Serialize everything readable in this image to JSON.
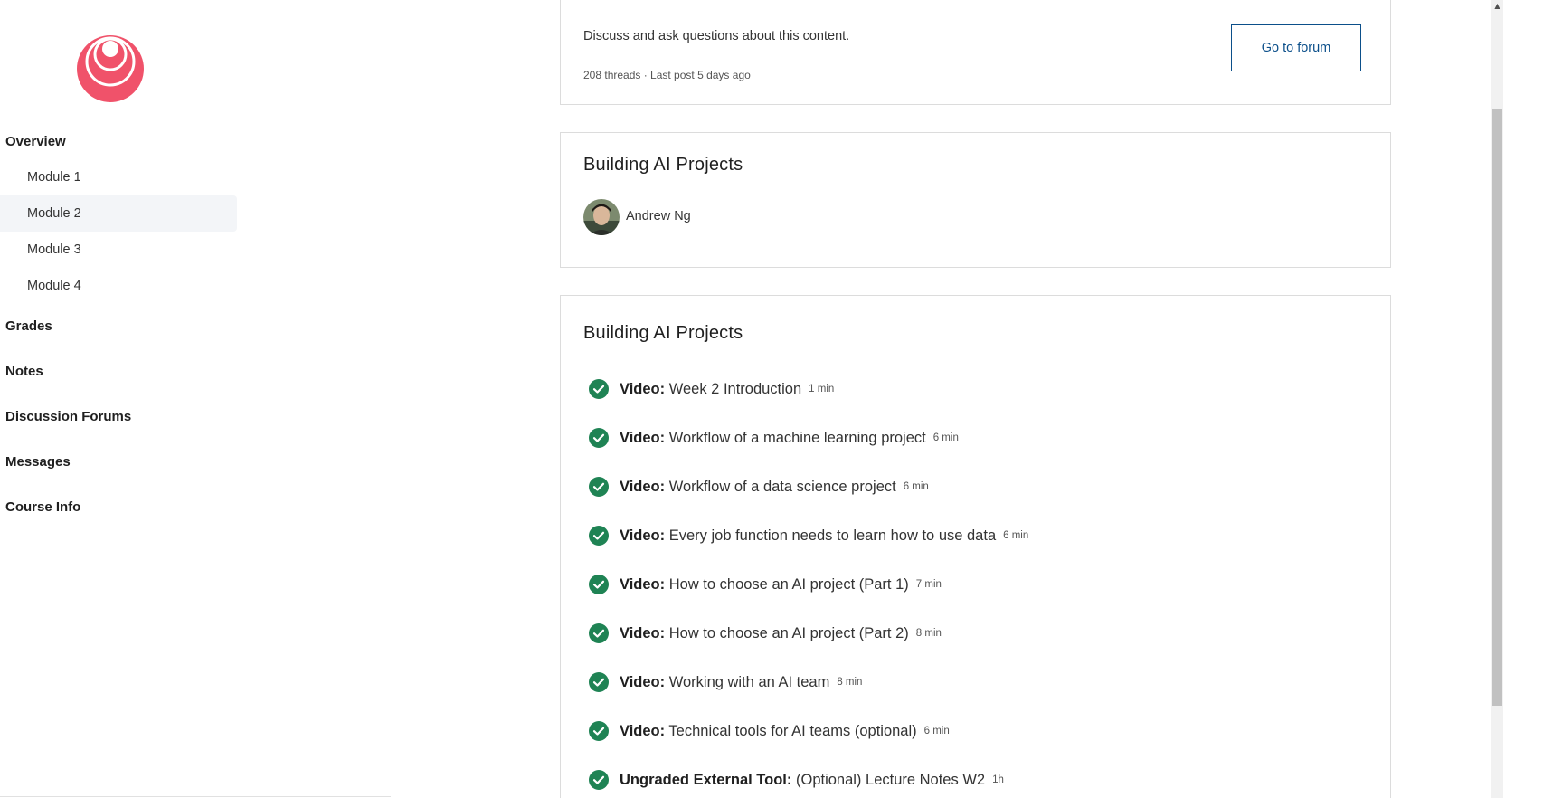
{
  "sidebar": {
    "items": [
      {
        "label": "Overview",
        "type": "top"
      },
      {
        "label": "Module 1",
        "type": "sub"
      },
      {
        "label": "Module 2",
        "type": "sub",
        "active": true
      },
      {
        "label": "Module 3",
        "type": "sub"
      },
      {
        "label": "Module 4",
        "type": "sub"
      },
      {
        "label": "Grades",
        "type": "top"
      },
      {
        "label": "Notes",
        "type": "top"
      },
      {
        "label": "Discussion Forums",
        "type": "top"
      },
      {
        "label": "Messages",
        "type": "top"
      },
      {
        "label": "Course Info",
        "type": "top"
      }
    ]
  },
  "forum": {
    "description": "Discuss and ask questions about this content.",
    "meta": "208 threads · Last post 5 days ago",
    "button_label": "Go to forum"
  },
  "instructor_card": {
    "title": "Building AI Projects",
    "instructor_name": "Andrew Ng"
  },
  "lessons_card": {
    "title": "Building AI Projects",
    "items": [
      {
        "type": "Video:",
        "title": "Week 2 Introduction",
        "duration": "1 min",
        "completed": true
      },
      {
        "type": "Video:",
        "title": "Workflow of a machine learning project",
        "duration": "6 min",
        "completed": true
      },
      {
        "type": "Video:",
        "title": "Workflow of a data science project",
        "duration": "6 min",
        "completed": true
      },
      {
        "type": "Video:",
        "title": "Every job function needs to learn how to use data",
        "duration": "6 min",
        "completed": true
      },
      {
        "type": "Video:",
        "title": "How to choose an AI project (Part 1)",
        "duration": "7 min",
        "completed": true
      },
      {
        "type": "Video:",
        "title": "How to choose an AI project (Part 2)",
        "duration": "8 min",
        "completed": true
      },
      {
        "type": "Video:",
        "title": "Working with an AI team",
        "duration": "8 min",
        "completed": true
      },
      {
        "type": "Video:",
        "title": "Technical tools for AI teams (optional)",
        "duration": "6 min",
        "completed": true
      },
      {
        "type": "Ungraded External Tool:",
        "title": "(Optional) Lecture Notes W2",
        "duration": "1h",
        "completed": true
      }
    ]
  },
  "colors": {
    "brand": "#f0526a",
    "check_green": "#1f8354",
    "link_blue": "#0b4f8a",
    "active_bg": "#f3f5f8"
  },
  "icons": {
    "logo": "course-logo",
    "check": "check-circle-icon"
  }
}
